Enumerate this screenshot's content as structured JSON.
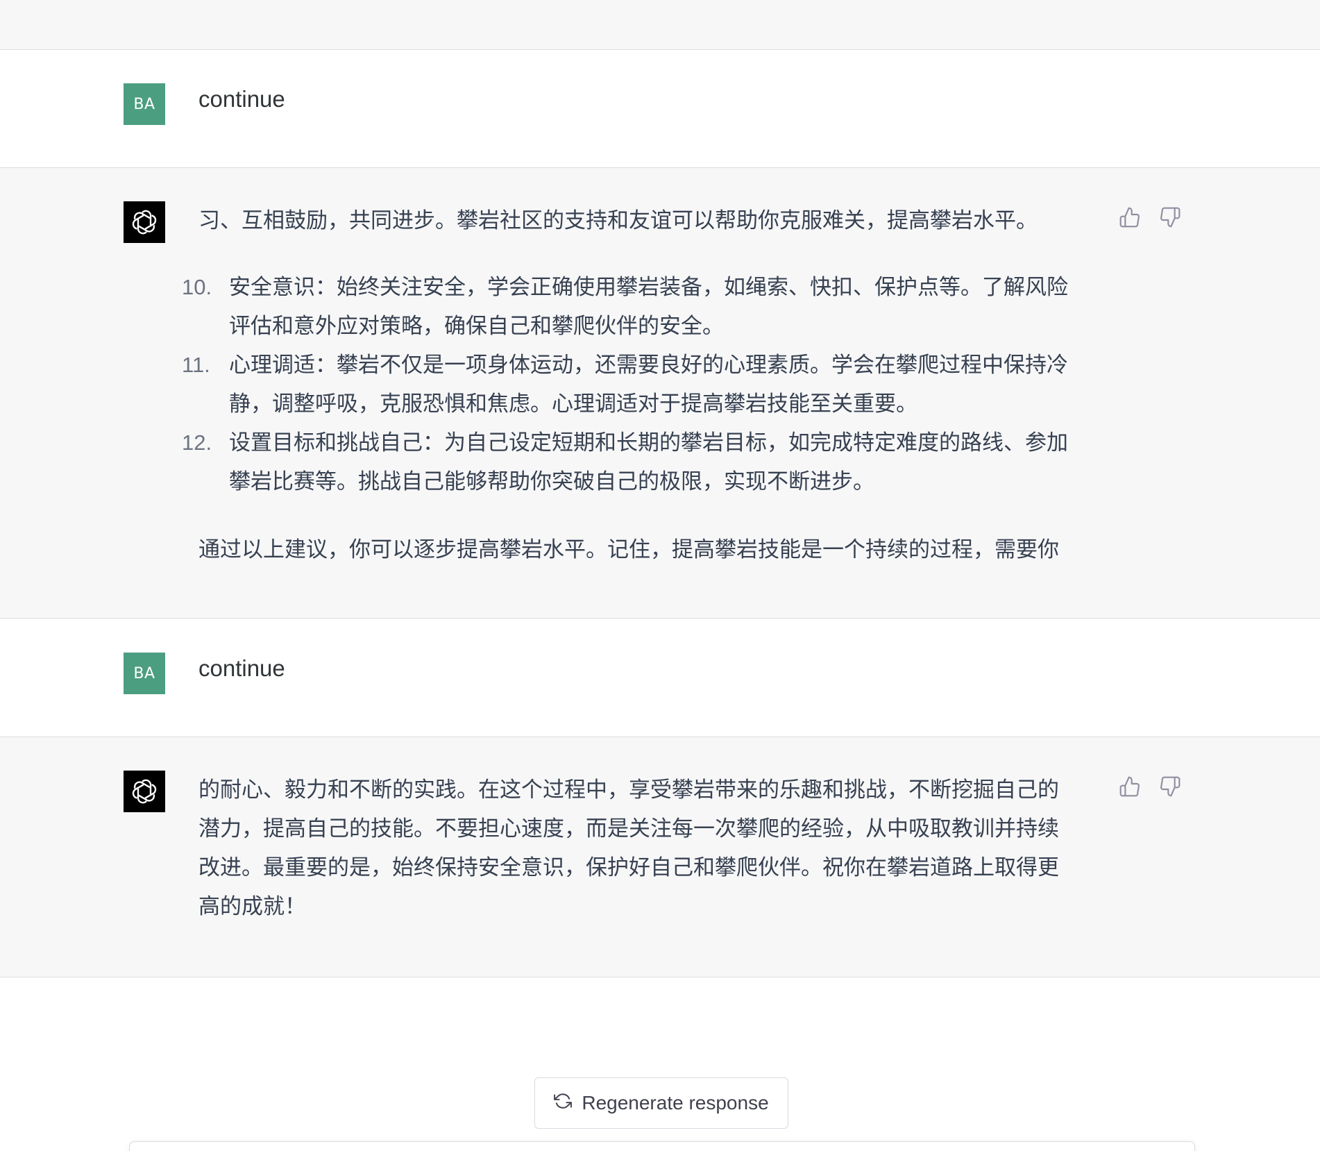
{
  "conversation": {
    "turns": [
      {
        "role": "user",
        "avatar_initials": "BA",
        "text": "continue"
      },
      {
        "role": "assistant",
        "intro": "习、互相鼓励，共同进步。攀岩社区的支持和友谊可以帮助你克服难关，提高攀岩水平。",
        "list": [
          {
            "number": "10.",
            "line1": "安全意识：始终关注安全，学会正确使用攀岩装备，如绳索、快扣、保护点等。了解风险",
            "line2": "评估和意外应对策略，确保自己和攀爬伙伴的安全。"
          },
          {
            "number": "11.",
            "line1": "心理调适：攀岩不仅是一项身体运动，还需要良好的心理素质。学会在攀爬过程中保持冷",
            "line2": "静，调整呼吸，克服恐惧和焦虑。心理调适对于提高攀岩技能至关重要。"
          },
          {
            "number": "12.",
            "line1": "设置目标和挑战自己：为自己设定短期和长期的攀岩目标，如完成特定难度的路线、参加",
            "line2": "攀岩比赛等。挑战自己能够帮助你突破自己的极限，实现不断进步。"
          }
        ],
        "outro": "通过以上建议，你可以逐步提高攀岩水平。记住，提高攀岩技能是一个持续的过程，需要你"
      },
      {
        "role": "user",
        "avatar_initials": "BA",
        "text": "continue"
      },
      {
        "role": "assistant",
        "lines": [
          "的耐心、毅力和不断的实践。在这个过程中，享受攀岩带来的乐趣和挑战，不断挖掘自己的",
          "潜力，提高自己的技能。不要担心速度，而是关注每一次攀爬的经验，从中吸取教训并持续",
          "改进。最重要的是，始终保持安全意识，保护好自己和攀爬伙伴。祝你在攀岩道路上取得更",
          "高的成就！"
        ]
      }
    ]
  },
  "regenerate_label": "Regenerate response",
  "colors": {
    "user_avatar_bg": "#4c9e80",
    "bot_avatar_bg": "#000000",
    "assistant_row_bg": "#f7f7f8",
    "text": "#374151"
  },
  "icons": {
    "assistant_avatar": "openai-logo-icon",
    "feedback_up": "thumbs-up-icon",
    "feedback_down": "thumbs-down-icon",
    "regenerate": "refresh-icon"
  }
}
